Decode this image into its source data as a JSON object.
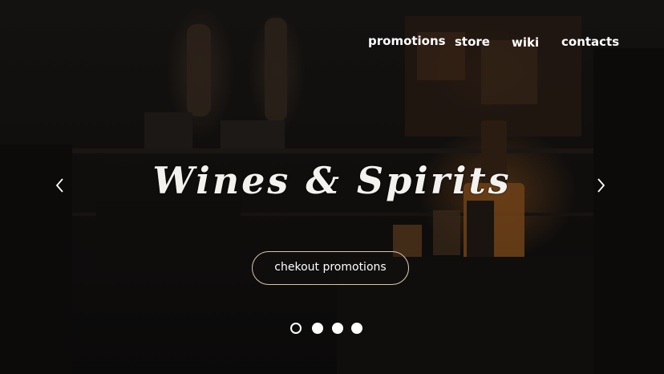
{
  "nav": {
    "items": [
      {
        "label": "promotions"
      },
      {
        "label": "store"
      },
      {
        "label": "wiki"
      },
      {
        "label": "contacts"
      }
    ]
  },
  "hero": {
    "title": "Wines & Spirits",
    "cta_label": "chekout promotions",
    "prev_icon": "chevron-left-icon",
    "next_icon": "chevron-right-icon",
    "slides": {
      "total": 4,
      "active": 1
    }
  },
  "colors": {
    "background": "#0d0c0b",
    "text": "#ffffff",
    "button_border": "#d8c6a8"
  }
}
